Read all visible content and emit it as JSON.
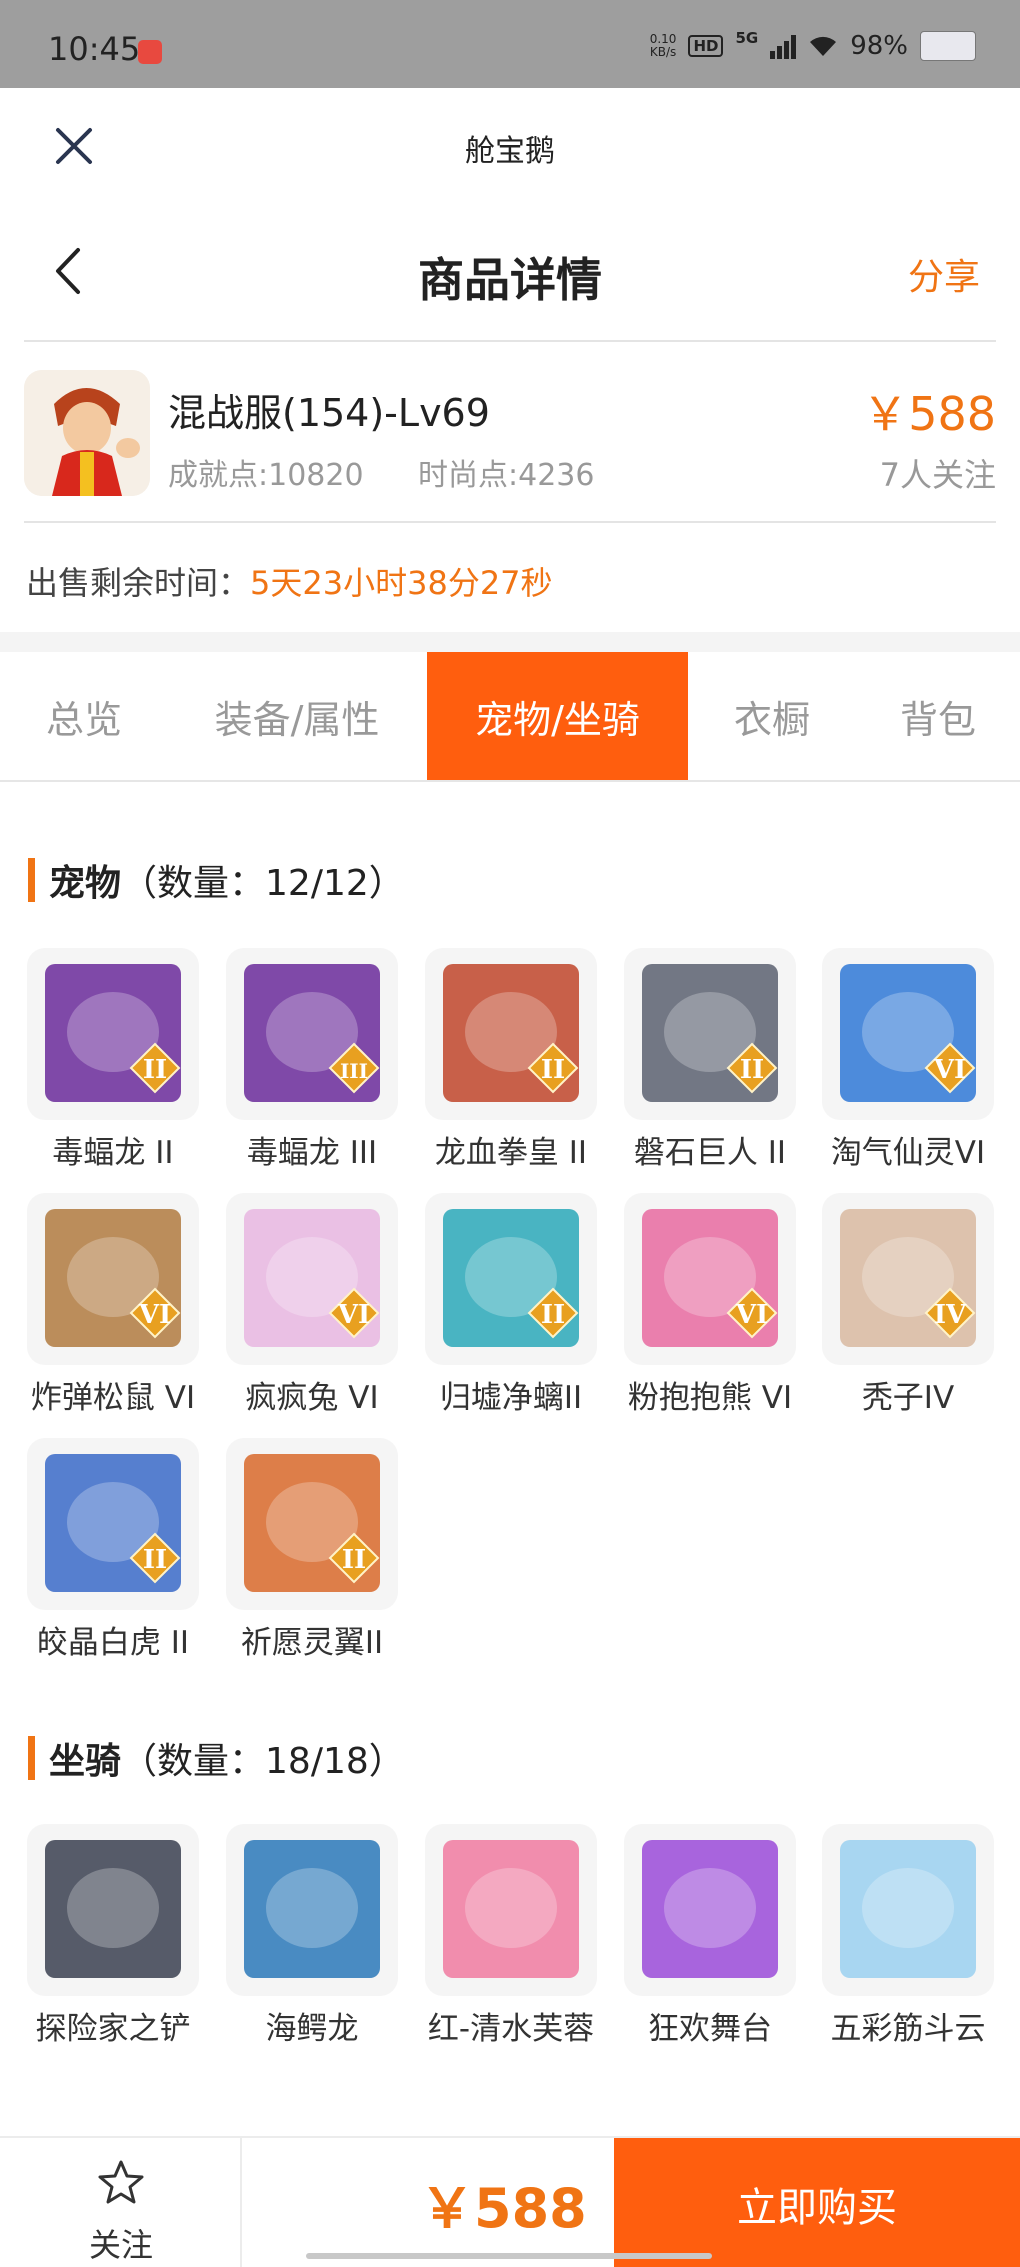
{
  "status_bar": {
    "time": "10:45",
    "net_speed": "0.10",
    "net_speed_unit": "KB/s",
    "hd": "HD",
    "network": "5G",
    "battery": "98%"
  },
  "app_bar": {
    "title": "舱宝鹅",
    "close_icon": "close-icon"
  },
  "header": {
    "title": "商品详情",
    "share": "分享"
  },
  "product": {
    "name": "混战服(154)-Lv69",
    "achievement": "成就点:10820",
    "fashion": "时尚点:4236",
    "price": "￥588",
    "followers": "7人关注",
    "remain_label": "出售剩余时间：",
    "remain_value": "5天23小时38分27秒"
  },
  "tabs": [
    {
      "label": "总览"
    },
    {
      "label": "装备/属性"
    },
    {
      "label": "宠物/坐骑"
    },
    {
      "label": "衣橱"
    },
    {
      "label": "背包"
    }
  ],
  "pets": {
    "title": "宠物",
    "count": "（数量：12/12）",
    "items": [
      {
        "label": "毒蝠龙 II",
        "badge": "II",
        "color": "#6a2a9a"
      },
      {
        "label": "毒蝠龙 III",
        "badge": "III",
        "color": "#6a2a9a"
      },
      {
        "label": "龙血拳皇 II",
        "badge": "II",
        "color": "#c0452a"
      },
      {
        "label": "磐石巨人 II",
        "badge": "II",
        "color": "#5a6070"
      },
      {
        "label": "淘气仙灵VI",
        "badge": "VI",
        "color": "#2f78d6"
      },
      {
        "label": "炸弹松鼠 VI",
        "badge": "VI",
        "color": "#b07a40"
      },
      {
        "label": "疯疯兔 VI",
        "badge": "VI",
        "color": "#e8b6e0"
      },
      {
        "label": "归墟净螭II",
        "badge": "II",
        "color": "#2aa8b8"
      },
      {
        "label": "粉抱抱熊 VI",
        "badge": "VI",
        "color": "#e86aa0"
      },
      {
        "label": "秃子IV",
        "badge": "IV",
        "color": "#d8b8a0"
      },
      {
        "label": "皎晶白虎 II",
        "badge": "II",
        "color": "#3a6ac8"
      },
      {
        "label": "祈愿灵翼II",
        "badge": "II",
        "color": "#d8682a"
      }
    ]
  },
  "mounts": {
    "title": "坐骑",
    "count": "（数量：18/18）",
    "items": [
      {
        "label": "探险家之铲",
        "color": "#3a4050"
      },
      {
        "label": "海鳄龙",
        "color": "#2a78b8"
      },
      {
        "label": "红-清水芙蓉",
        "color": "#f07aa0"
      },
      {
        "label": "狂欢舞台",
        "color": "#9a4ad8"
      },
      {
        "label": "五彩筋斗云",
        "color": "#9ad0f0"
      }
    ]
  },
  "bottom": {
    "follow": "关注",
    "price": "￥588",
    "buy": "立即购买"
  }
}
